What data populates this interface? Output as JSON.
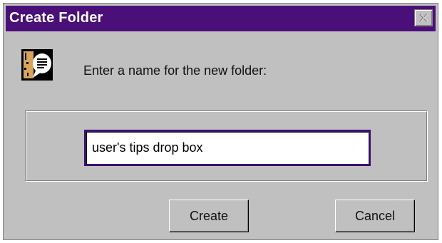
{
  "window": {
    "title": "Create Folder",
    "close_icon": "close-icon"
  },
  "dialog": {
    "icon": "folder-speech-icon",
    "prompt": "Enter a name for the new folder:",
    "folder_name_value": "user's tips drop box"
  },
  "buttons": {
    "create_label": "Create",
    "cancel_label": "Cancel"
  },
  "colors": {
    "titlebar": "#4b0f7a",
    "dialog_bg": "#c0c0c0",
    "input_border": "#3c0f73"
  }
}
